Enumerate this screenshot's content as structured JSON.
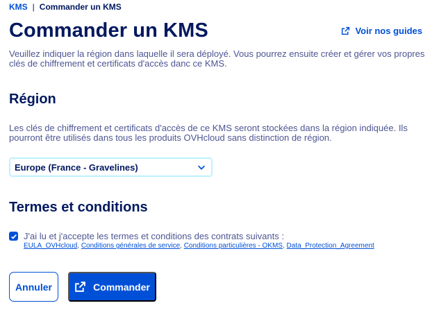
{
  "breadcrumb": {
    "root": "KMS",
    "separator": "|",
    "current": "Commander un KMS"
  },
  "header": {
    "title": "Commander un KMS",
    "guides_link": "Voir nos guides",
    "guides_icon": "external-link-icon"
  },
  "intro_text": "Veuillez indiquer la région dans laquelle il sera déployé. Vous pourrez ensuite créer et gérer vos propres clés de chiffrement et certificats d'accès danc ce KMS.",
  "region": {
    "title": "Région",
    "description": "Les clés de chiffrement et certificats d'accès de ce KMS seront stockées dans la région indiquée. Ils pourront être utilisés dans tous les produits OVHcloud sans distinction de région.",
    "selected": "Europe (France - Gravelines)"
  },
  "terms": {
    "title": "Termes et conditions",
    "accept_text": "J'ai lu et j'accepte les termes et conditions des contrats suivants :",
    "checked": true,
    "links": [
      "EULA_OVHcloud",
      "Conditions générales de service",
      "Conditions particulières - OKMS",
      "Data_Protection_Agreement"
    ],
    "link_separator": ", "
  },
  "actions": {
    "cancel_label": "Annuler",
    "order_label": "Commander"
  },
  "colors": {
    "primary": "#0050d7",
    "heading": "#00185e",
    "text": "#4d5592",
    "select_border": "#bef1ff"
  }
}
